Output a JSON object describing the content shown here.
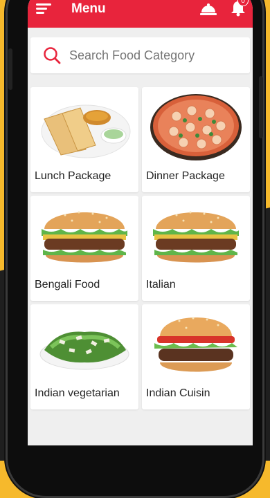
{
  "header": {
    "title": "Menu",
    "notification_count": "0"
  },
  "search": {
    "placeholder": "Search Food Category"
  },
  "categories": [
    {
      "label": "Lunch Package",
      "icon": "lunch-package-image"
    },
    {
      "label": "Dinner Package",
      "icon": "pizza-image"
    },
    {
      "label": "Bengali Food",
      "icon": "burger-image"
    },
    {
      "label": "Italian",
      "icon": "burger-image"
    },
    {
      "label": "Indian vegetarian",
      "icon": "salad-image"
    },
    {
      "label": "Indian Cuisin",
      "icon": "burger-image"
    }
  ],
  "colors": {
    "accent": "#e8243c",
    "background": "#f6b92c"
  }
}
